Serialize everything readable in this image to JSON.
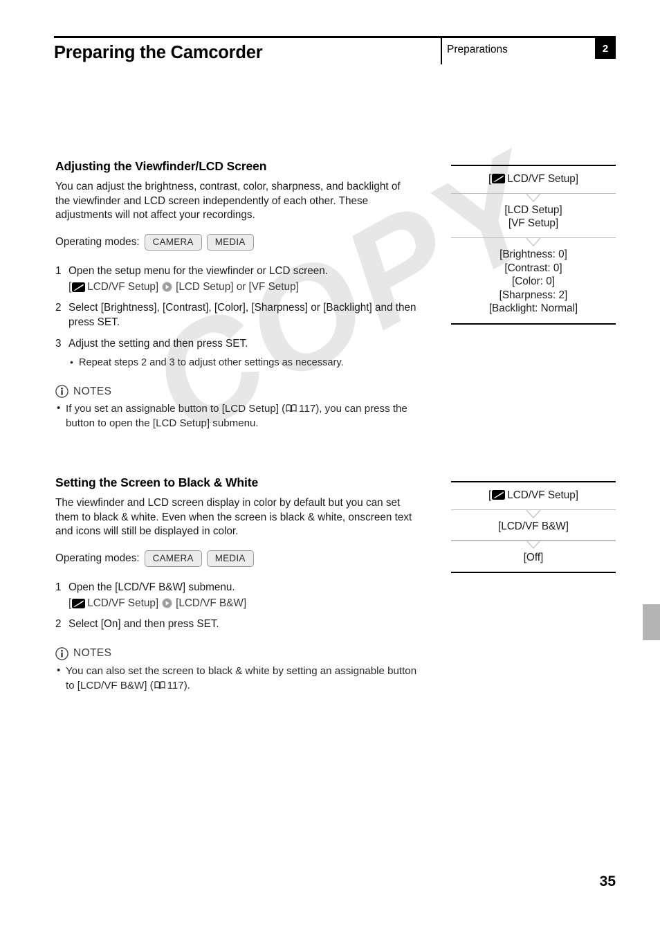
{
  "header": {
    "title": "Preparing the Camcorder",
    "section": "Preparations",
    "chapter": "2"
  },
  "sections": [
    {
      "title": "Adjusting the Viewfinder/LCD Screen",
      "intro": "You can adjust the brightness, contrast, color, sharpness, and backlight of the viewfinder and LCD screen independently of each other. These adjustments will not affect your recordings.",
      "operating_modes_label": "Operating modes:",
      "modes": [
        "CAMERA",
        "MEDIA"
      ],
      "steps": [
        {
          "num": "1",
          "text": "Open the setup menu for the viewfinder or LCD screen.",
          "path_open": "[",
          "path_menu": "LCD/VF Setup]",
          "path_target": "[LCD Setup] or [VF Setup]"
        },
        {
          "num": "2",
          "text": "Select [Brightness], [Contrast], [Color], [Sharpness] or [Backlight] and then press SET."
        },
        {
          "num": "3",
          "text": "Adjust the setting and then press SET.",
          "substeps": [
            "Repeat steps 2 and 3 to adjust other settings as necessary."
          ]
        }
      ],
      "notes_label": "NOTES",
      "notes": [
        {
          "pre": "If you set an assignable button to [LCD Setup] (",
          "page_ref": "117",
          "post": "), you can press the button to open the [LCD Setup] submenu."
        }
      ]
    },
    {
      "title": "Setting the Screen to Black & White",
      "intro": "The viewfinder and LCD screen display in color by default but you can set them to black & white. Even when the screen is black & white, onscreen text and icons will still be displayed in color.",
      "operating_modes_label": "Operating modes:",
      "modes": [
        "CAMERA",
        "MEDIA"
      ],
      "steps": [
        {
          "num": "1",
          "text": "Open the [LCD/VF B&W] submenu.",
          "path_open": "[",
          "path_menu": "LCD/VF Setup]",
          "path_target": "[LCD/VF B&W]"
        },
        {
          "num": "2",
          "text": "Select [On] and then press SET."
        }
      ],
      "notes_label": "NOTES",
      "notes": [
        {
          "pre": "You can also set the screen to black & white by setting an assignable button to [LCD/VF B&W] (",
          "page_ref": "117",
          "post": ")."
        }
      ]
    }
  ],
  "menu_boxes": [
    {
      "root_bracket_open": "[",
      "root_label": "LCD/VF Setup]",
      "levels": [
        "[LCD Setup]\n[VF Setup]",
        "[Brightness: 0]\n[Contrast: 0]\n[Color: 0]\n[Sharpness: 2]\n[Backlight: Normal]"
      ]
    },
    {
      "root_bracket_open": "[",
      "root_label": "LCD/VF Setup]",
      "levels": [
        "[LCD/VF B&W]",
        "[Off]"
      ]
    }
  ],
  "watermark": "COPY",
  "page_number": "35",
  "icons": {
    "lcd_vf": "lcd-vf-icon",
    "arrow": "arrow-right-circle-icon",
    "book": "book-page-reference-icon",
    "info": "info-circle-icon"
  },
  "colors": {
    "text": "#1a1a1a",
    "rule": "#000000",
    "separator": "#bdbdbd",
    "chip_bg": "#ececec",
    "watermark": "#e7e7e7",
    "edge_tab": "#b4b4b4"
  }
}
